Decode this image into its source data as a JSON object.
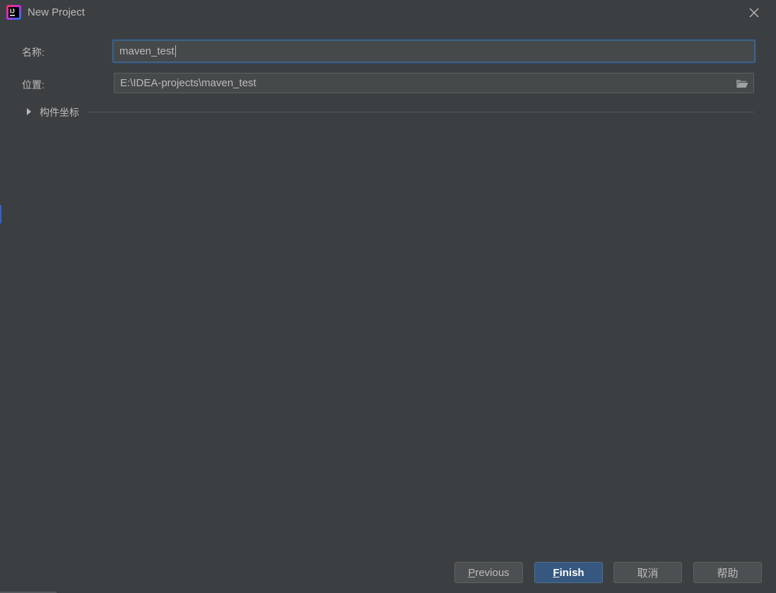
{
  "window": {
    "title": "New Project",
    "app_icon": "intellij-idea-icon",
    "close_icon": "close-icon"
  },
  "form": {
    "name_label": "名称:",
    "name_value": "maven_test",
    "location_label": "位置:",
    "location_value": "E:\\IDEA-projects\\maven_test",
    "browse_icon": "folder-icon"
  },
  "section": {
    "artifact_coordinates_label": "构件坐标",
    "expanded": false
  },
  "buttons": {
    "previous_first": "P",
    "previous_rest": "revious",
    "finish_first": "F",
    "finish_rest": "inish",
    "cancel": "取消",
    "help": "帮助"
  },
  "colors": {
    "background": "#3c3f41",
    "field_background": "#45494a",
    "focus_border": "#3d6185",
    "primary_button": "#365880",
    "text": "#bbbbbb"
  }
}
